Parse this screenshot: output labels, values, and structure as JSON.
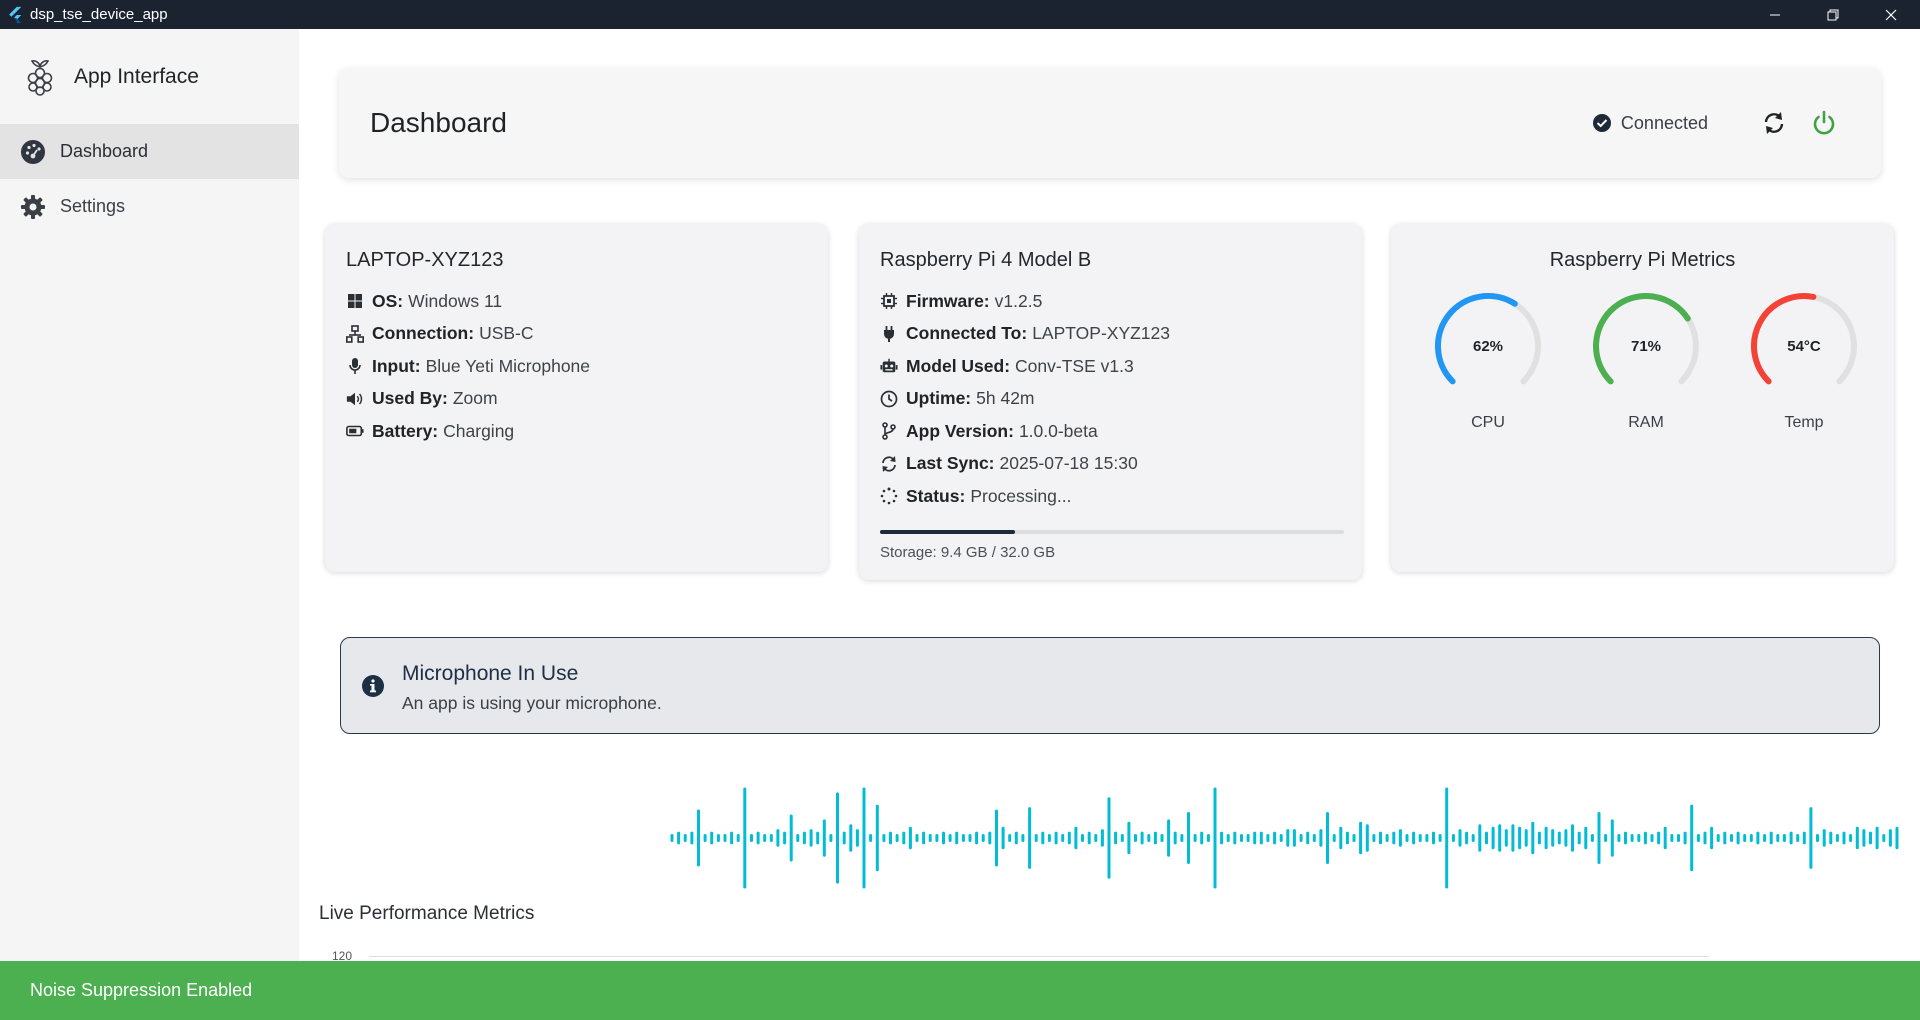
{
  "window": {
    "title": "dsp_tse_device_app"
  },
  "sidebar": {
    "brand": "App Interface",
    "items": [
      {
        "label": "Dashboard",
        "icon": "dashboard-icon",
        "active": true
      },
      {
        "label": "Settings",
        "icon": "gear-icon",
        "active": false
      }
    ]
  },
  "header": {
    "title": "Dashboard",
    "status": "Connected",
    "accent_green": "#43a047"
  },
  "laptop_card": {
    "title": "LAPTOP-XYZ123",
    "rows": [
      {
        "icon": "windows-icon",
        "label": "OS:",
        "value": "Windows 11"
      },
      {
        "icon": "network-icon",
        "label": "Connection:",
        "value": "USB-C"
      },
      {
        "icon": "microphone-icon",
        "label": "Input:",
        "value": "Blue Yeti Microphone"
      },
      {
        "icon": "speaker-icon",
        "label": "Used By:",
        "value": "Zoom"
      },
      {
        "icon": "battery-icon",
        "label": "Battery:",
        "value": "Charging"
      }
    ]
  },
  "pi_card": {
    "title": "Raspberry Pi 4 Model B",
    "rows": [
      {
        "icon": "chip-icon",
        "label": "Firmware:",
        "value": "v1.2.5"
      },
      {
        "icon": "plug-icon",
        "label": "Connected To:",
        "value": "LAPTOP-XYZ123"
      },
      {
        "icon": "robot-icon",
        "label": "Model Used:",
        "value": "Conv-TSE v1.3"
      },
      {
        "icon": "clock-icon",
        "label": "Uptime:",
        "value": "5h 42m"
      },
      {
        "icon": "branch-icon",
        "label": "App Version:",
        "value": "1.0.0-beta"
      },
      {
        "icon": "sync-icon",
        "label": "Last Sync:",
        "value": "2025-07-18 15:30"
      },
      {
        "icon": "spinner-icon",
        "label": "Status:",
        "value": "Processing..."
      }
    ],
    "storage_text": "Storage: 9.4 GB / 32.0 GB",
    "storage_fraction": 0.29
  },
  "metrics_card": {
    "title": "Raspberry Pi Metrics",
    "gauges": [
      {
        "label": "CPU",
        "value_text": "62%",
        "fraction": 0.62,
        "color": "#2196f3"
      },
      {
        "label": "RAM",
        "value_text": "71%",
        "fraction": 0.71,
        "color": "#4caf50"
      },
      {
        "label": "Temp",
        "value_text": "54°C",
        "fraction": 0.54,
        "color": "#f44336"
      }
    ]
  },
  "alert": {
    "title": "Microphone In Use",
    "text": "An app is using your microphone."
  },
  "waveform": {
    "color": "#00bcd4",
    "levels": [
      0.05,
      0.1,
      0.05,
      0.1,
      0.55,
      0.05,
      0.1,
      0.05,
      0.05,
      0.1,
      0.05,
      1.0,
      0.05,
      0.1,
      0.05,
      0.05,
      0.15,
      0.1,
      0.45,
      0.05,
      0.1,
      0.15,
      0.1,
      0.35,
      0.05,
      0.9,
      0.1,
      0.25,
      0.15,
      1.0,
      0.05,
      0.65,
      0.05,
      0.1,
      0.05,
      0.1,
      0.2,
      0.05,
      0.1,
      0.05,
      0.05,
      0.1,
      0.05,
      0.1,
      0.05,
      0.05,
      0.1,
      0.05,
      0.1,
      0.55,
      0.2,
      0.05,
      0.1,
      0.05,
      0.6,
      0.05,
      0.1,
      0.05,
      0.1,
      0.05,
      0.1,
      0.2,
      0.05,
      0.1,
      0.05,
      0.15,
      0.8,
      0.1,
      0.05,
      0.3,
      0.05,
      0.1,
      0.05,
      0.1,
      0.05,
      0.35,
      0.1,
      0.05,
      0.5,
      0.05,
      0.1,
      0.05,
      1.0,
      0.1,
      0.05,
      0.1,
      0.05,
      0.05,
      0.1,
      0.1,
      0.05,
      0.1,
      0.05,
      0.15,
      0.15,
      0.05,
      0.1,
      0.05,
      0.15,
      0.5,
      0.05,
      0.2,
      0.1,
      0.05,
      0.3,
      0.25,
      0.05,
      0.1,
      0.05,
      0.1,
      0.15,
      0.05,
      0.1,
      0.05,
      0.05,
      0.1,
      0.05,
      1.0,
      0.05,
      0.15,
      0.1,
      0.05,
      0.25,
      0.1,
      0.2,
      0.25,
      0.15,
      0.25,
      0.2,
      0.15,
      0.3,
      0.1,
      0.2,
      0.15,
      0.1,
      0.15,
      0.25,
      0.1,
      0.2,
      0.05,
      0.5,
      0.05,
      0.35,
      0.05,
      0.1,
      0.05,
      0.05,
      0.1,
      0.05,
      0.1,
      0.2,
      0.05,
      0.05,
      0.1,
      0.65,
      0.05,
      0.1,
      0.2,
      0.05,
      0.1,
      0.05,
      0.1,
      0.05,
      0.05,
      0.1,
      0.05,
      0.1,
      0.05,
      0.05,
      0.1,
      0.05,
      0.1,
      0.6,
      0.05,
      0.15,
      0.1,
      0.05,
      0.1,
      0.05,
      0.2,
      0.15,
      0.1,
      0.2,
      0.05,
      0.15,
      0.2
    ]
  },
  "performance": {
    "title": "Live Performance Metrics",
    "y_tick_top": "120"
  },
  "toast": {
    "text": "Noise Suppression Enabled"
  }
}
